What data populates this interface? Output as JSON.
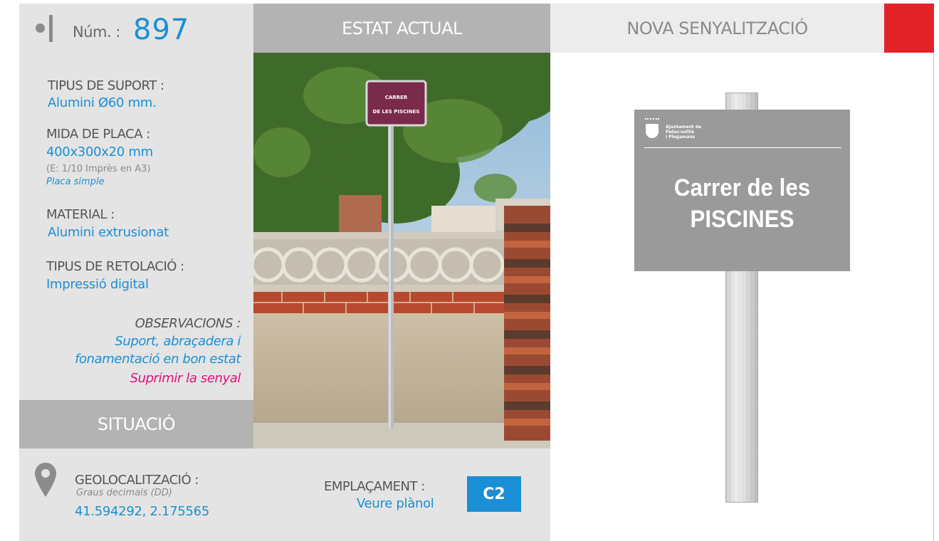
{
  "header": {
    "num_label": "Núm. :",
    "num_value": "897",
    "estat_actual": "ESTAT ACTUAL",
    "nova_senyalitzacio": "NOVA SENYALITZACIÓ"
  },
  "info": {
    "tipus_suport_label": "TIPUS DE SUPORT :",
    "tipus_suport_value": "Alumini Ø60 mm.",
    "mida_placa_label": "MIDA DE PLACA :",
    "mida_placa_value": "400x300x20 mm",
    "mida_placa_scale": "(E: 1/10 Imprès en A3)",
    "mida_placa_type": "Placa simple",
    "material_label": "MATERIAL :",
    "material_value": "Alumini extrusionat",
    "retolacio_label": "TIPUS DE RETOLACIÓ :",
    "retolacio_value": "Impressió digital",
    "observacions_label": "OBSERVACIONS :",
    "observacions_line1": "Suport, abraçadera i",
    "observacions_line2": "fonamentació en bon estat",
    "observacions_action": "Suprimir la senyal"
  },
  "situacio": {
    "title": "SITUACIÓ",
    "geo_label": "GEOLOCALITZACIÓ :",
    "geo_format": "Graus decimals (DD)",
    "geo_value": "41.594292, 2.175565",
    "emplacament_label": "EMPLAÇAMENT :",
    "emplacament_link": "Veure plànol",
    "emplacament_code": "C2"
  },
  "photo_sign": {
    "line1": "CARRER",
    "line2": "DE LES PISCINES"
  },
  "new_sign": {
    "logo_line1": "Ajuntament de",
    "logo_line2": "Palau-solità",
    "logo_line3": "i Plegamans",
    "title_line1": "Carrer de les",
    "title_line2": "PISCINES"
  },
  "colors": {
    "accent_blue": "#1a8fd6",
    "accent_red": "#e3232a",
    "accent_magenta": "#e0107a"
  }
}
